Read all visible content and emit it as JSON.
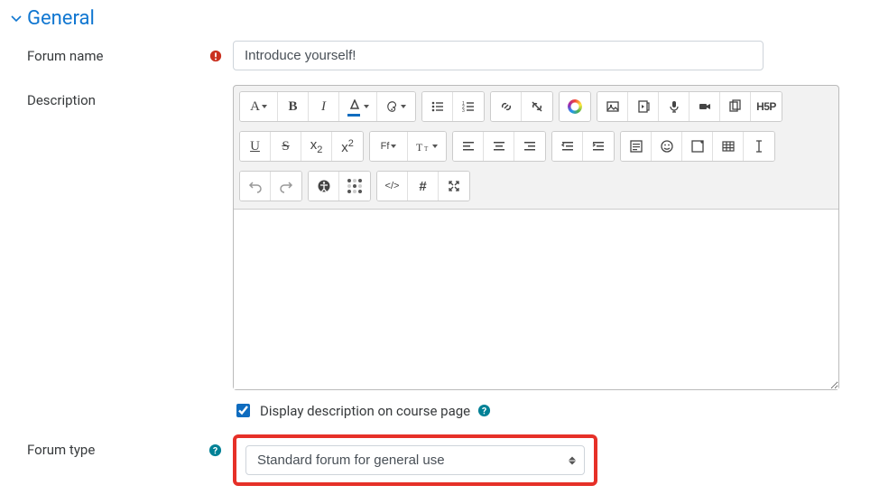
{
  "section": {
    "title": "General"
  },
  "fields": {
    "forum_name": {
      "label": "Forum name",
      "value": "Introduce yourself!"
    },
    "description": {
      "label": "Description"
    },
    "display_desc": {
      "label": "Display description on course page",
      "checked": true
    },
    "forum_type": {
      "label": "Forum type",
      "selected": "Standard forum for general use"
    }
  },
  "icons": {
    "required_title": "Required",
    "help_title": "Help"
  }
}
